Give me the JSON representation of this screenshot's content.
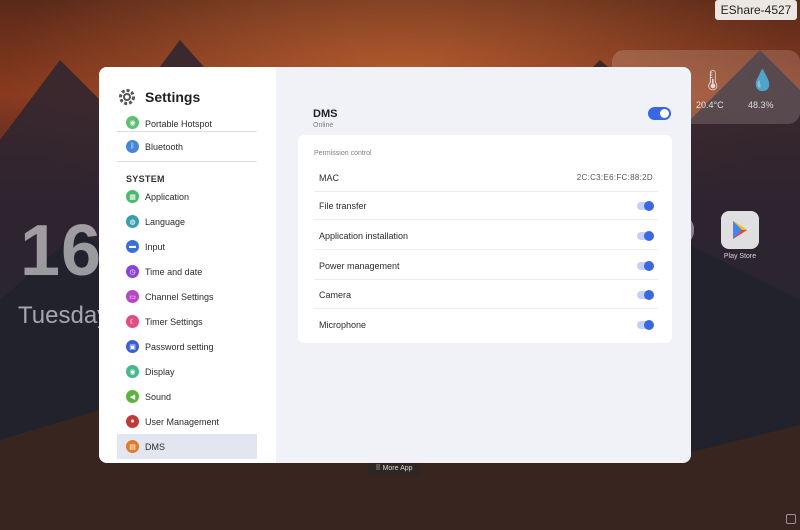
{
  "desktop": {
    "device_name": "EShare-4527",
    "clock": "16",
    "day": "Tuesday",
    "weather": {
      "temperature": "20.4°C",
      "humidity": "48.3%"
    },
    "apps": [
      {
        "label": "Play Store"
      }
    ],
    "more_app_label": "More App"
  },
  "settings": {
    "title": "Settings",
    "sidebar": {
      "items_top": [
        {
          "label": "Portable Hotspot",
          "icon": "hotspot-icon",
          "color": "#5fbf72"
        },
        {
          "label": "Bluetooth",
          "icon": "bluetooth-icon",
          "color": "#4a86d8"
        }
      ],
      "section_label": "SYSTEM",
      "items": [
        {
          "label": "Application",
          "icon": "apps-icon",
          "color": "#4bb86c"
        },
        {
          "label": "Language",
          "icon": "globe-icon",
          "color": "#3b9eb0"
        },
        {
          "label": "Input",
          "icon": "keyboard-icon",
          "color": "#3c6fd6"
        },
        {
          "label": "Time and date",
          "icon": "clock-icon",
          "color": "#8a43d2"
        },
        {
          "label": "Channel Settings",
          "icon": "channel-icon",
          "color": "#b746c4"
        },
        {
          "label": "Timer Settings",
          "icon": "timer-icon",
          "color": "#e04c84"
        },
        {
          "label": "Password setting",
          "icon": "lock-icon",
          "color": "#3b5fd3"
        },
        {
          "label": "Display",
          "icon": "display-icon",
          "color": "#46b88c"
        },
        {
          "label": "Sound",
          "icon": "sound-icon",
          "color": "#5cb43e"
        },
        {
          "label": "User Management",
          "icon": "user-icon",
          "color": "#c03a3a"
        },
        {
          "label": "DMS",
          "icon": "dms-icon",
          "color": "#e07b2a",
          "active": true
        }
      ]
    },
    "main": {
      "title": "DMS",
      "status": "Online",
      "enabled": true,
      "card_title": "Permission control",
      "rows": [
        {
          "label": "MAC",
          "value": "2C:C3:E6:FC:88:2D"
        },
        {
          "label": "File transfer",
          "on": true
        },
        {
          "label": "Application installation",
          "on": true
        },
        {
          "label": "Power management",
          "on": true
        },
        {
          "label": "Camera",
          "on": true
        },
        {
          "label": "Microphone",
          "on": true
        }
      ]
    }
  },
  "colors": {
    "accent": "#3b67e0",
    "active_item_bg": "#e3e6f1",
    "dialog_bg": "#f1f2f7"
  }
}
